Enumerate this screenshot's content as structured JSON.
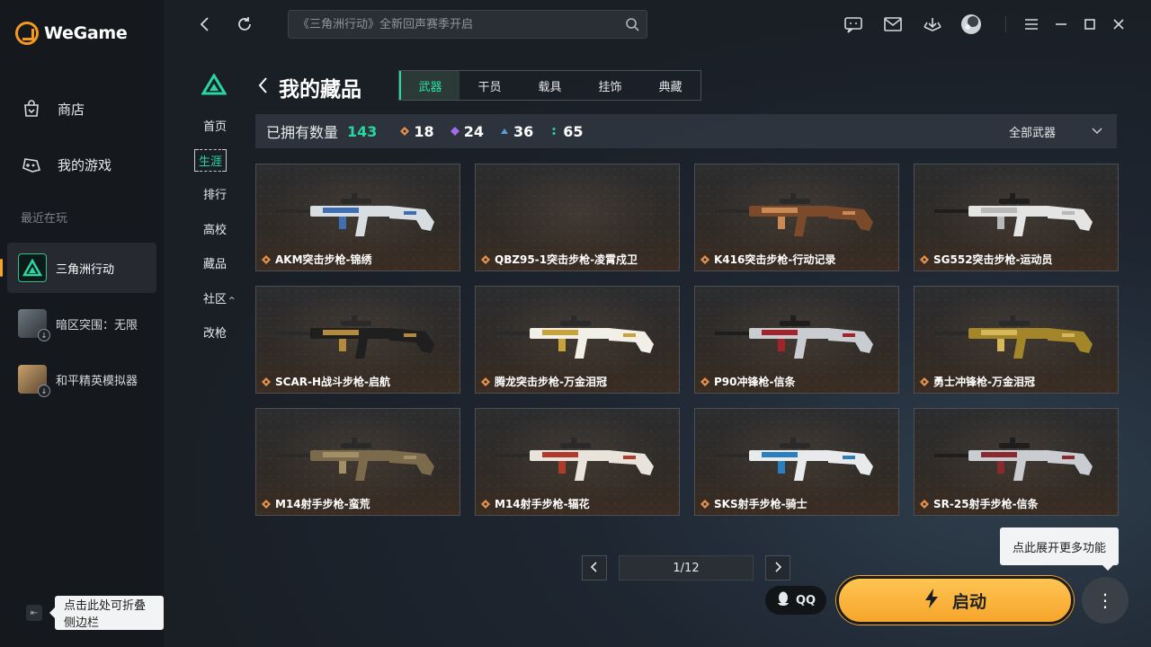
{
  "app": {
    "name": "WeGame"
  },
  "sidebar": {
    "store": "商店",
    "my_games": "我的游戏",
    "recent_title": "最近在玩",
    "recent": [
      {
        "label": "三角洲行动",
        "active": true
      },
      {
        "label": "暗区突围：无限",
        "active": false
      },
      {
        "label": "和平精英模拟器",
        "active": false
      }
    ],
    "collapse_tip": "点击此处可折叠侧边栏"
  },
  "topbar": {
    "search_placeholder": "《三角洲行动》全新回声赛季开启"
  },
  "game_nav": {
    "items": [
      "首页",
      "生涯",
      "排行",
      "高校",
      "藏品",
      "社区",
      "改枪"
    ],
    "active_index": 1
  },
  "collection": {
    "title": "我的藏品",
    "tabs": [
      "武器",
      "干员",
      "载具",
      "挂饰",
      "典藏"
    ],
    "active_tab": 0,
    "owned_label": "已拥有数量",
    "owned_total": "143",
    "rarity_counts": [
      {
        "color": "#e8914a",
        "count": "18"
      },
      {
        "color": "#a26cf0",
        "count": "24"
      },
      {
        "color": "#5b9de0",
        "count": "36"
      },
      {
        "color": "#2ed6a0",
        "count": "65"
      }
    ],
    "filter_label": "全部武器",
    "items": [
      {
        "name": "AKM突击步枪-锦绣",
        "palette": [
          "#d8dde2",
          "#3f6fb3",
          "#2a2a2a"
        ]
      },
      {
        "name": "QBZ95-1突击步枪-凌霄戍卫",
        "palette": [
          "#2e2e2e",
          "#2e2e2e",
          "#2e2e2e"
        ]
      },
      {
        "name": "K416突击步枪-行动记录",
        "palette": [
          "#7a4a2a",
          "#c98a55",
          "#2a2a2a"
        ]
      },
      {
        "name": "SG552突击步枪-运动员",
        "palette": [
          "#e4e4e4",
          "#b8b8b8",
          "#1e1e1e"
        ]
      },
      {
        "name": "SCAR-H战斗步枪-启航",
        "palette": [
          "#1f1f1f",
          "#b58a3a",
          "#2a2a2a"
        ]
      },
      {
        "name": "腾龙突击步枪-万金泪冠",
        "palette": [
          "#f2efe6",
          "#c9a23a",
          "#2a2a2a"
        ]
      },
      {
        "name": "P90冲锋枪-信条",
        "palette": [
          "#c9ccd0",
          "#a3232a",
          "#1e1e1e"
        ]
      },
      {
        "name": "勇士冲锋枪-万金泪冠",
        "palette": [
          "#a4862a",
          "#d6b85a",
          "#2a2a2a"
        ]
      },
      {
        "name": "M14射手步枪-蛮荒",
        "palette": [
          "#7b6a4c",
          "#a38f66",
          "#2a2a2a"
        ]
      },
      {
        "name": "M14射手步枪-辐花",
        "palette": [
          "#e8e4dc",
          "#b23a2a",
          "#2a2a2a"
        ]
      },
      {
        "name": "SKS射手步枪-骑士",
        "palette": [
          "#e8eaec",
          "#2a7fc0",
          "#2a2a2a"
        ]
      },
      {
        "name": "SR-25射手步枪-信条",
        "palette": [
          "#c9ccd0",
          "#8a2a2e",
          "#1e1e1e"
        ]
      }
    ],
    "pagination": "1/12"
  },
  "launch": {
    "qq": "QQ",
    "start": "启动",
    "more_tip": "点此展开更多功能"
  }
}
